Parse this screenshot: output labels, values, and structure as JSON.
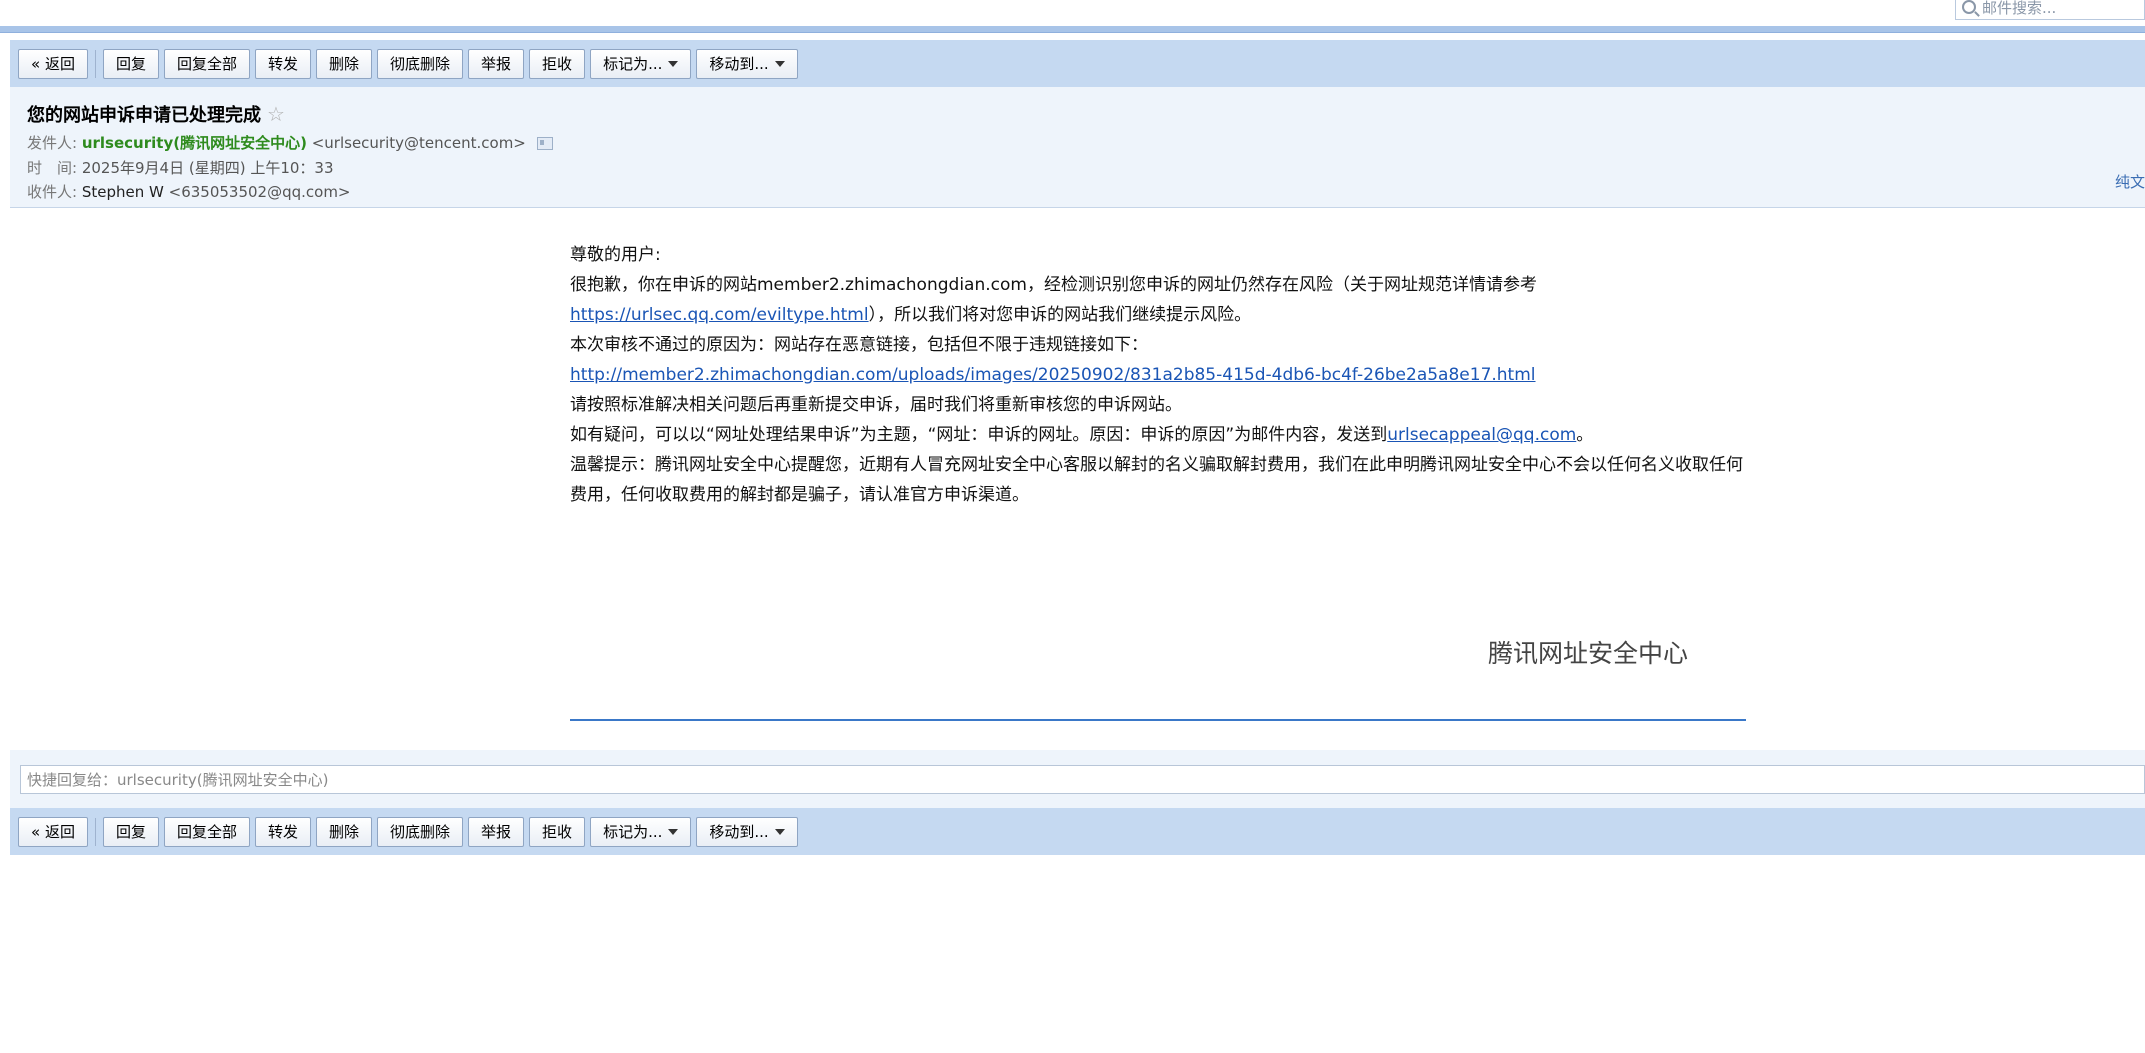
{
  "search": {
    "placeholder": "邮件搜索..."
  },
  "toolbar": {
    "back": "« 返回",
    "reply": "回复",
    "reply_all": "回复全部",
    "forward": "转发",
    "delete": "删除",
    "delete_permanently": "彻底删除",
    "report": "举报",
    "reject": "拒收",
    "mark_as": "标记为...",
    "move_to": "移动到..."
  },
  "header": {
    "subject": "您的网站申诉申请已处理完成",
    "from_label": "发件人:",
    "from_name": "urlsecurity(腾讯网址安全中心)",
    "from_addr": "<urlsecurity@tencent.com>",
    "time_label": "时　间:",
    "time_value": "2025年9月4日 (星期四) 上午10：33",
    "to_label": "收件人:",
    "to_name": "Stephen W",
    "to_addr": "<635053502@qq.com>",
    "plain_text_link": "纯文"
  },
  "body": {
    "greeting": "尊敬的用户:",
    "line1": "很抱歉，你在申诉的网站member2.zhimachongdian.com，经检测识别您申诉的网址仍然存在风险（关于网址规范详情请参考",
    "link1": "https://urlsec.qq.com/eviltype.html",
    "line2_rest": "），所以我们将对您申诉的网站我们继续提示风险。",
    "line3": "本次审核不通过的原因为：网站存在恶意链接，包括但不限于违规链接如下：",
    "link2": "http://member2.zhimachongdian.com/uploads/images/20250902/831a2b85-415d-4db6-bc4f-26be2a5a8e17.html",
    "line4": "请按照标准解决相关问题后再重新提交申诉，届时我们将重新审核您的申诉网站。",
    "line5_pre": "如有疑问，可以以“网址处理结果申诉”为主题，“网址：申诉的网址。原因：申诉的原因”为邮件内容，发送到",
    "link3": "urlsecappeal@qq.com",
    "line5_post": "。",
    "line6": "温馨提示：腾讯网址安全中心提醒您，近期有人冒充网址安全中心客服以解封的名义骗取解封费用，我们在此申明腾讯网址安全中心不会以任何名义收取任何费用，任何收取费用的解封都是骗子，请认准官方申诉渠道。",
    "signature": "腾讯网址安全中心"
  },
  "quick_reply": {
    "placeholder": "快捷回复给：urlsecurity(腾讯网址安全中心)"
  }
}
